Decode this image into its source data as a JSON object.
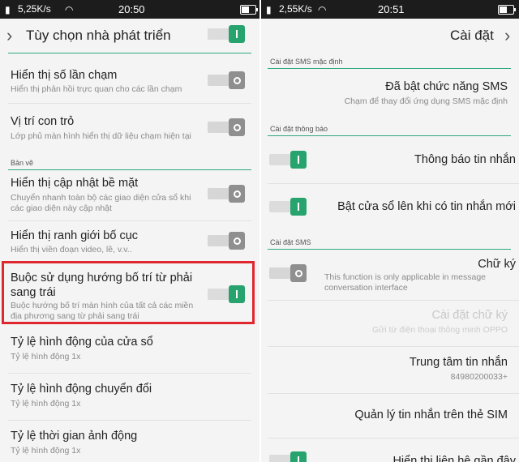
{
  "left": {
    "status": {
      "speed": "5,25K/s",
      "time": "20:50"
    },
    "title": "Tùy chọn nhà phát triển",
    "dev_toggle": "on",
    "section_draw": "Bản vẽ",
    "rows": [
      {
        "title": "Hiển thị số lần chạm",
        "sub": "Hiển thị phản hồi trực quan cho các lần chạm"
      },
      {
        "title": "Vị trí con trỏ",
        "sub": "Lớp phủ màn hình hiển thị dữ liệu chạm hiện tại"
      },
      {
        "title": "Hiển thị cập nhật bề mặt",
        "sub": "Chuyển nhanh toàn bộ các giao diện cửa sổ khi các giao diện này cập nhật"
      },
      {
        "title": "Hiển thị ranh giới bố cục",
        "sub": "Hiển thị viền đoạn video, lề, v.v.."
      },
      {
        "title": "Buộc sử dụng hướng bố trí từ phải sang trái",
        "sub": "Buộc hướng bố trí màn hình của tất cả các miền địa phương sang từ phải sang trái"
      },
      {
        "title": "Tỷ lệ hình động của cửa sổ",
        "sub": "Tỷ lệ hình động 1x"
      },
      {
        "title": "Tỷ lệ hình động chuyển đổi",
        "sub": "Tỷ lệ hình động 1x"
      },
      {
        "title": "Tỷ lệ thời gian ảnh động",
        "sub": "Tỷ lệ hình động 1x"
      }
    ]
  },
  "right": {
    "status": {
      "speed": "2,55K/s",
      "time": "20:51"
    },
    "title": "Cài đặt",
    "section_default_sms": "Cài đặt SMS mặc định",
    "default_sms": {
      "title": "Đã bật chức năng SMS",
      "sub": "Chạm để thay đổi ứng dụng SMS mặc định"
    },
    "section_notify": "Cài đặt thông báo",
    "notify_rows": [
      {
        "title": "Thông báo tin nhắn"
      },
      {
        "title": "Bật cửa sổ lên khi có tin nhắn mới"
      }
    ],
    "section_sms": "Cài đặt SMS",
    "signature": {
      "title": "Chữ ký",
      "sub": "This function is only applicable in message conversation interface"
    },
    "signature_settings": {
      "title": "Cài đặt chữ ký",
      "sub": "Gửi từ điện thoại thông minh OPPO"
    },
    "message_center": {
      "title": "Trung tâm tin nhắn",
      "sub": "84980200033+"
    },
    "sim_manage": {
      "title": "Quản lý tin nhắn trên thẻ SIM"
    },
    "cut_row": {
      "title": "Hiển thị liên hệ gần đây"
    }
  }
}
